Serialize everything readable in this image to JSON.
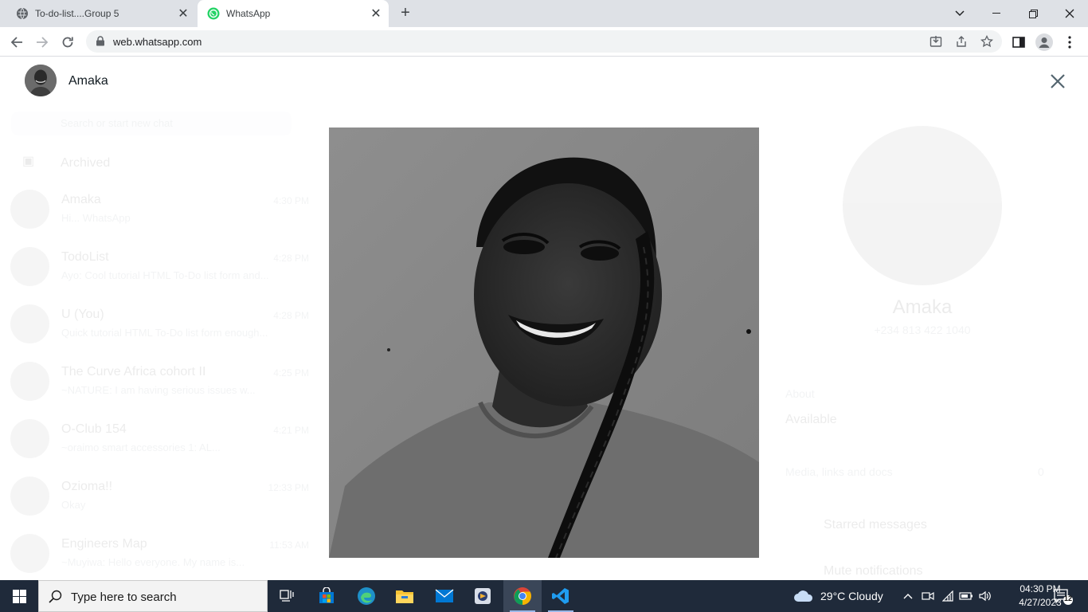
{
  "browser": {
    "tabs": [
      {
        "title": "To-do-list....Group 5",
        "icon": "globe-icon"
      },
      {
        "title": "WhatsApp",
        "icon": "whatsapp-icon"
      }
    ],
    "url": "web.whatsapp.com"
  },
  "viewer": {
    "contact_name": "Amaka"
  },
  "background": {
    "search_placeholder": "Search or start new chat",
    "archived_label": "Archived",
    "chats": [
      {
        "name": "Amaka",
        "time": "4:30 PM",
        "preview": "Hi... WhatsApp"
      },
      {
        "name": "TodoList",
        "time": "4:28 PM",
        "preview": "Ayo: Cool tutorial HTML To-Do list form and..."
      },
      {
        "name": "U (You)",
        "time": "4:28 PM",
        "preview": "Quick tutorial HTML To-Do list form enough..."
      },
      {
        "name": "The Curve Africa cohort II",
        "time": "4:25 PM",
        "preview": "~NATURE: I am having serious issues w..."
      },
      {
        "name": "O-Club 154",
        "time": "4:21 PM",
        "preview": "~oraimo smart accessories 1: AL..."
      },
      {
        "name": "Ozioma!!",
        "time": "12:33 PM",
        "preview": "Okay"
      },
      {
        "name": "Engineers Map",
        "time": "11:53 AM",
        "preview": "~Muyiwa: Hello everyone. My name is..."
      }
    ],
    "profile": {
      "name": "Amaka",
      "phone": "+234 813 422 1040",
      "about_label": "About",
      "about_value": "Available",
      "media_label": "Media, links and docs",
      "media_count": "0",
      "starred_label": "Starred messages",
      "mute_label": "Mute notifications"
    }
  },
  "taskbar": {
    "search_placeholder": "Type here to search",
    "weather": "29°C  Cloudy",
    "time": "04:30 PM",
    "date": "4/27/2023",
    "notification_count": "12"
  }
}
